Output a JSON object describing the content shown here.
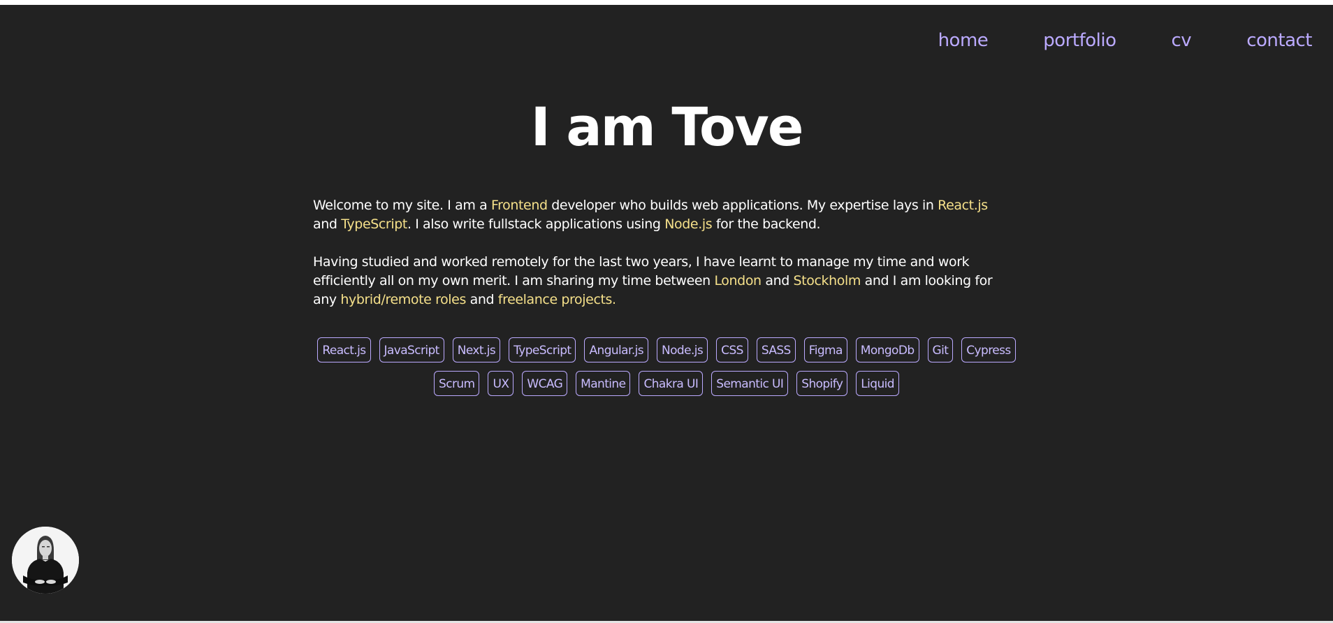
{
  "nav": {
    "items": [
      "home",
      "portfolio",
      "cv",
      "contact"
    ]
  },
  "hero": {
    "title": "I am Tove"
  },
  "intro": {
    "p1": {
      "t1": "Welcome to my site. I am a ",
      "h1": "Frontend",
      "t2": " developer who builds web applications. My expertise lays in ",
      "h2": "React.js",
      "t3": " and ",
      "h3": "TypeScript",
      "t4": ". I also write fullstack applications using ",
      "h4": "Node.js",
      "t5": " for the backend."
    },
    "p2": {
      "t1": "Having studied and worked remotely for the last two years, I have learnt to manage my time and work efficiently all on my own merit. I am sharing my time between ",
      "h1": "London",
      "t2": " and ",
      "h2": "Stockholm",
      "t3": " and I am looking for any ",
      "h3": "hybrid/remote roles",
      "t4": " and ",
      "h4": "freelance projects."
    }
  },
  "skills": [
    "React.js",
    "JavaScript",
    "Next.js",
    "TypeScript",
    "Angular.js",
    "Node.js",
    "CSS",
    "SASS",
    "Figma",
    "MongoDb",
    "Git",
    "Cypress",
    "Scrum",
    "UX",
    "WCAG",
    "Mantine",
    "Chakra UI",
    "Semantic UI",
    "Shopify",
    "Liquid"
  ],
  "colors": {
    "background": "#222222",
    "accent_link": "#bbaaff",
    "highlight": "#f5e08a"
  },
  "avatar": {
    "icon": "profile-photo"
  }
}
